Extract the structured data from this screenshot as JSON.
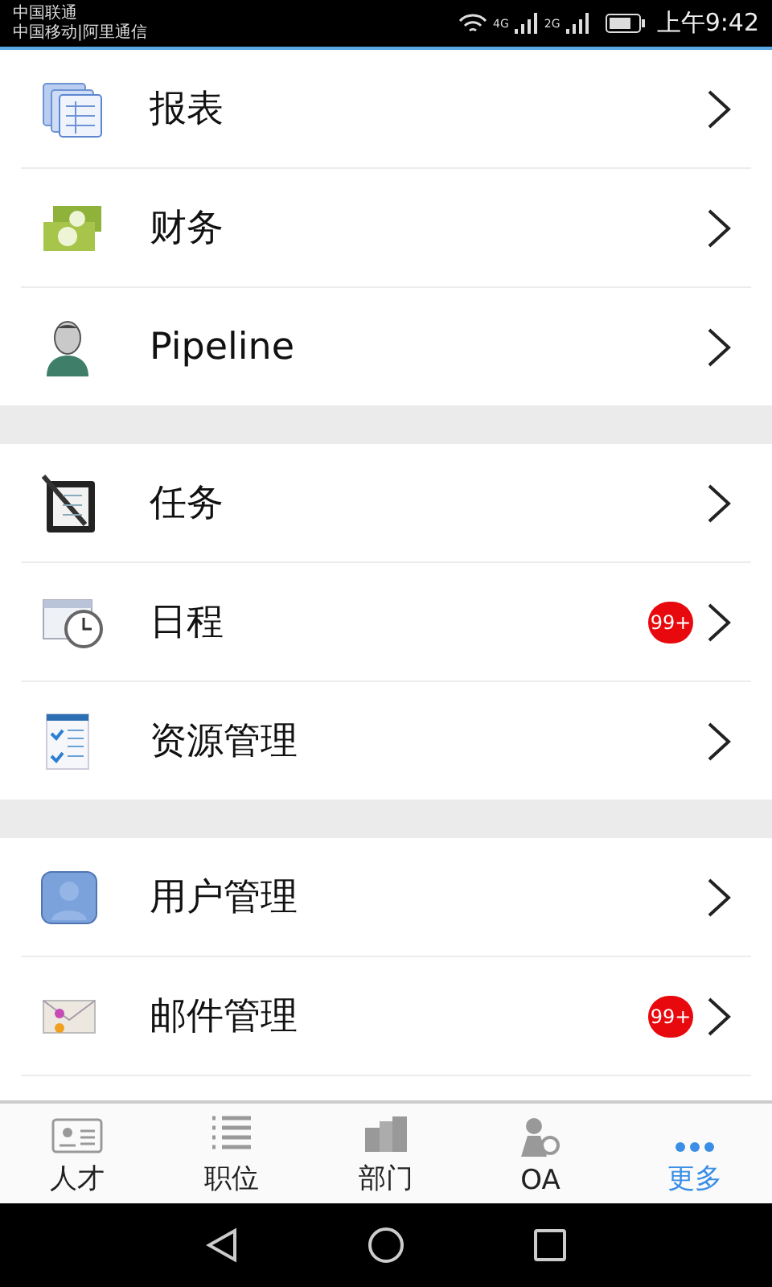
{
  "status_bar": {
    "carriers": [
      "中国联通",
      "中国移动|阿里通信"
    ],
    "networks": [
      "4G",
      "2G"
    ],
    "time": "上午9:42"
  },
  "groups": [
    {
      "items": [
        {
          "kind": "report",
          "label": "报表"
        },
        {
          "kind": "money",
          "label": "财务"
        },
        {
          "kind": "person",
          "label": "Pipeline"
        }
      ]
    },
    {
      "items": [
        {
          "kind": "task",
          "label": "任务"
        },
        {
          "kind": "calendar",
          "label": "日程",
          "badge": "99+"
        },
        {
          "kind": "checklist",
          "label": "资源管理"
        }
      ]
    },
    {
      "items": [
        {
          "kind": "user",
          "label": "用户管理"
        },
        {
          "kind": "mail",
          "label": "邮件管理",
          "badge": "99+"
        }
      ]
    }
  ],
  "tabs": [
    {
      "kind": "card",
      "label": "人才",
      "selected": false
    },
    {
      "kind": "list",
      "label": "职位",
      "selected": false
    },
    {
      "kind": "building",
      "label": "部门",
      "selected": false
    },
    {
      "kind": "gearperson",
      "label": "OA",
      "selected": false
    },
    {
      "kind": "dots",
      "label": "更多",
      "selected": true
    }
  ]
}
